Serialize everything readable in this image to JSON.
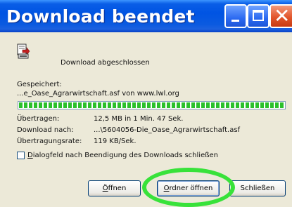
{
  "window": {
    "title": "Download beendet"
  },
  "status": {
    "message": "Download abgeschlossen"
  },
  "saved": {
    "label": "Gespeichert:",
    "value": "...e_Oase_Agrarwirtschaft.asf von www.lwl.org"
  },
  "progress": {
    "percent": 100,
    "color": "#2bc02b"
  },
  "details": [
    {
      "label": "Übertragen:",
      "value": "12,5 MB in 1 Min. 47 Sek."
    },
    {
      "label": "Download nach:",
      "value": "...\\5604056-Die_Oase_Agrarwirtschaft.asf"
    },
    {
      "label": "Übertragungsrate:",
      "value": "119 KB/Sek."
    }
  ],
  "option": {
    "mnemonic": "D",
    "rest": "ialogfeld nach Beendigung des Downloads schließen",
    "checked": false
  },
  "buttons": {
    "open": {
      "mnemonic": "Ö",
      "rest": "ffnen"
    },
    "open_folder": {
      "mnemonic": "O",
      "rest": "rdner öffnen"
    },
    "close": "Schließen"
  },
  "annotation": {
    "color": "#38e23a"
  }
}
